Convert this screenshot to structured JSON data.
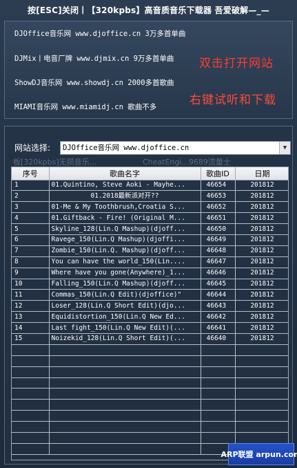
{
  "window": {
    "title": "按[ESC]关闭丨【320kpbs】高音质音乐下载器 吾爱破解—_—"
  },
  "sites": [
    {
      "text": "DJOffice音乐网  www.djoffice.cn  3万多首单曲"
    },
    {
      "text": "DJMix丨电音厂牌 www.djmix.cn 9万多首单曲"
    },
    {
      "text": "ShowDJ音乐网 www.showdj.cn 2000多首歌曲"
    },
    {
      "text": "MIAMI音乐网 www.miamidj.cn 歌曲不多"
    }
  ],
  "hints": {
    "open": "双击打开网站",
    "listen": "右键试听和下载",
    "open_color": "#ff3b30",
    "listen_color": "#ff4a3a"
  },
  "selector": {
    "label": "网站选择:",
    "value": "DJOffice音乐网  www.djoffice.cn"
  },
  "ghost": {
    "left": "板[320kpbs]无损音乐...",
    "right": "CheatEngi...9689流量士"
  },
  "table": {
    "headers": [
      "序号",
      "歌曲名字",
      "歌曲ID",
      "日期"
    ],
    "rows": [
      {
        "no": "1",
        "name": "01.Quintino, Steve Aoki - Mayhe...",
        "id": "46654",
        "date": "201812"
      },
      {
        "no": "2",
        "name": "01.2018最新派对开??",
        "id": "46653",
        "date": "201812"
      },
      {
        "no": "3",
        "name": "01-Me & My Toothbrush,Croatia S...",
        "id": "46652",
        "date": "201812"
      },
      {
        "no": "4",
        "name": "01.Giftback - Fire! (Original M...",
        "id": "46651",
        "date": "201812"
      },
      {
        "no": "5",
        "name": "Skyline_128(Lin.Q Mashup)(djoff...",
        "id": "46650",
        "date": "201812"
      },
      {
        "no": "6",
        "name": "Ravege_150(Lin.Q Mashup)(djoffi...",
        "id": "46649",
        "date": "201812"
      },
      {
        "no": "7",
        "name": "Zombie_150(Lin.Q. Mashup)(djoff...",
        "id": "46648",
        "date": "201812"
      },
      {
        "no": "8",
        "name": "You can have the world_150(Lin....",
        "id": "46647",
        "date": "201812"
      },
      {
        "no": "9",
        "name": "Where have you gone(Anywhere)_1...",
        "id": "46646",
        "date": "201812"
      },
      {
        "no": "10",
        "name": "Falling_150(Lin.Q Mashup)(djoff...",
        "id": "46645",
        "date": "201812"
      },
      {
        "no": "11",
        "name": "Commas_150(Lin.Q Edit)(djoffice)\"",
        "id": "46644",
        "date": "201812"
      },
      {
        "no": "12",
        "name": "Loser_128(Lin.Q Short Edit)(djo...",
        "id": "46643",
        "date": "201812"
      },
      {
        "no": "13",
        "name": "Equidistortion_150(Lin.Q New Ed...",
        "id": "46642",
        "date": "201812"
      },
      {
        "no": "14",
        "name": "Last fight_150(Lin.Q New Edit)(...",
        "id": "46641",
        "date": "201812"
      },
      {
        "no": "15",
        "name": "Noizekid_128(Lin.Q Short Edit)(...",
        "id": "46640",
        "date": "201812"
      }
    ],
    "empty_rows": 10
  },
  "watermark": {
    "text": "ARP联盟 arpun.com"
  },
  "icons": {
    "dropdown": "chevron-down-icon"
  },
  "colors": {
    "background": "#223042",
    "panel_border": "#5a6b80",
    "header_bg": "#e6e9ed"
  }
}
